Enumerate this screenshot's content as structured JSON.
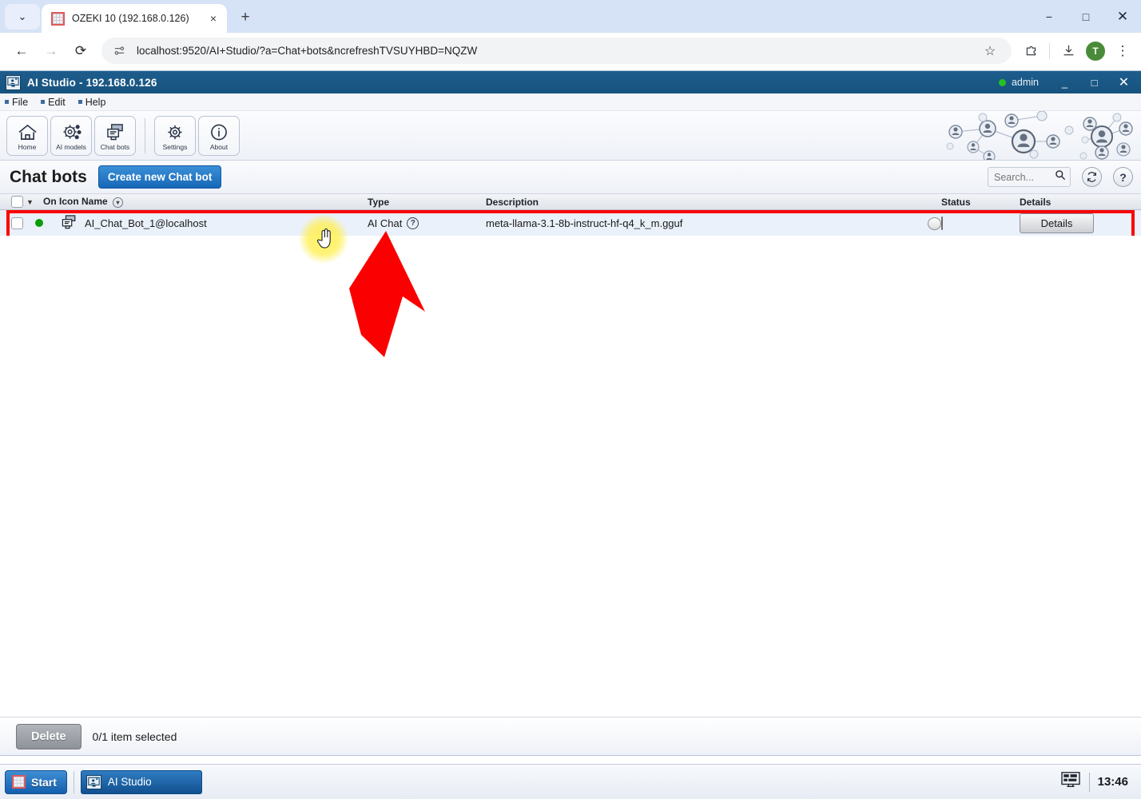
{
  "browser": {
    "tab": {
      "title": "OZEKI 10 (192.168.0.126)",
      "favicon": "grid-favicon",
      "close": "×",
      "new_tab": "+"
    },
    "tab_list_chevron": "⌄",
    "nav": {
      "back": "←",
      "forward": "→",
      "reload": "⟳"
    },
    "omnibox": {
      "url": "localhost:9520/AI+Studio/?a=Chat+bots&ncrefreshTVSUYHBD=NQZW",
      "site_icon": "site-settings-icon"
    },
    "actions": {
      "bookmark": "☆",
      "extensions": "extensions-icon",
      "download": "download-icon",
      "profile_initial": "T",
      "menu": "⋮"
    },
    "window_controls": {
      "minimize": "−",
      "maximize": "□",
      "close": "✕"
    }
  },
  "app": {
    "title": "AI Studio - 192.168.0.126",
    "user": "admin",
    "window_controls": {
      "minimize": "_",
      "maximize": "□",
      "close": "✕"
    },
    "menu": [
      "File",
      "Edit",
      "Help"
    ],
    "ribbon": [
      {
        "label": "Home",
        "icon": "home-icon"
      },
      {
        "label": "AI models",
        "icon": "gear-network-icon"
      },
      {
        "label": "Chat bots",
        "icon": "chatbot-icon"
      },
      {
        "label": "Settings",
        "icon": "gear-icon"
      },
      {
        "label": "About",
        "icon": "info-icon"
      }
    ]
  },
  "page": {
    "title": "Chat bots",
    "create_button": "Create new Chat bot",
    "search": {
      "placeholder": "Search...",
      "value": "",
      "icon": "search-icon"
    },
    "refresh_icon": "refresh-icon",
    "help_icon": "?",
    "table": {
      "columns": [
        "On",
        "Icon",
        "Name",
        "Type",
        "Description",
        "Status",
        "Details"
      ],
      "header_group_label": "On Icon Name",
      "col_type": "Type",
      "col_description": "Description",
      "col_status": "Status",
      "col_details": "Details",
      "rows": [
        {
          "selected": false,
          "on": true,
          "icon": "chatbot-icon",
          "name": "AI_Chat_Bot_1@localhost",
          "type": "AI Chat",
          "type_help": "?",
          "description": "meta-llama-3.1-8b-instruct-hf-q4_k_m.gguf",
          "status_enabled": true,
          "details_button": "Details"
        }
      ]
    },
    "footer": {
      "delete_button": "Delete",
      "selection_text": "0/1 item selected"
    }
  },
  "taskbar": {
    "start": "Start",
    "items": [
      {
        "label": "AI Studio",
        "icon": "ai-studio-icon"
      }
    ],
    "tray_icon": "display-icon",
    "clock": "13:46"
  },
  "annotations": {
    "highlight_color": "#fb0000",
    "cursor_glow_color": "#fff05a",
    "arrow_color": "#fb0000"
  }
}
